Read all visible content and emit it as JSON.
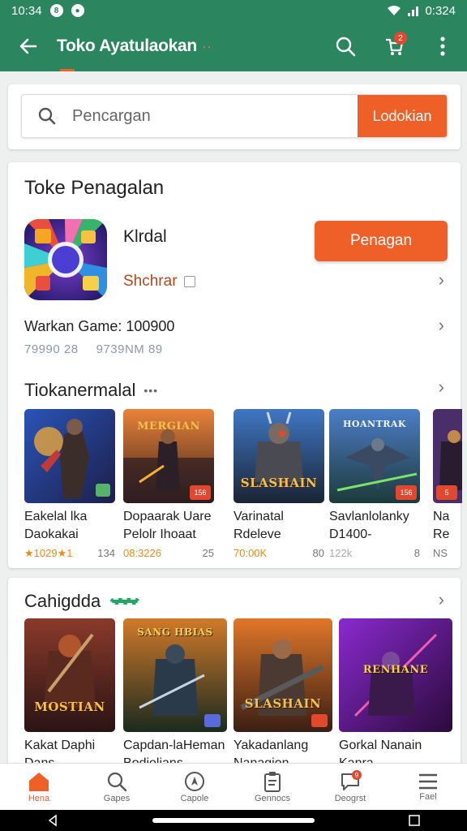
{
  "status_bar": {
    "time": "10:34",
    "battery": "0:324",
    "dot1": "8"
  },
  "app_bar": {
    "title": "Toko Ayatulaokan",
    "title_dots": "··",
    "cart_badge": "2"
  },
  "search": {
    "placeholder": "Pencargan",
    "button_label": "Lodokian"
  },
  "main_section": {
    "title": "Toke Penagalan",
    "featured": {
      "name": "Klrdal",
      "subtitle": "Shchrar",
      "button_label": "Penagan"
    },
    "meta_line": "Warkan Game: 100900",
    "stats": [
      "79990 28",
      "9739NM 89"
    ]
  },
  "row_section": {
    "title": "Tiokanermalal",
    "title_dots": "•••",
    "games": [
      {
        "name1": "Eakelal lka",
        "name2": "Daokakai",
        "rating": "★1029★1",
        "count": "134",
        "logo": "",
        "tag": ""
      },
      {
        "name1": "Dopaarak Uare",
        "name2": "Pelolr Ihoaat",
        "rating": "08:3226",
        "count": "25",
        "logo": "MERGIAN",
        "tag": "156"
      },
      {
        "name1": "Varinatal",
        "name2": "Rdeleve",
        "rating": "70:00K",
        "count": "80",
        "logo": "SLASHAIN",
        "tag": ""
      },
      {
        "name1": "Savlanlolanky",
        "name2": "D1400-",
        "rating": "122k",
        "count": "8",
        "logo": "HOANTRAK",
        "tag": "156"
      },
      {
        "name1": "Na",
        "name2": "Re",
        "rating": "",
        "count": "NS",
        "logo": "",
        "tag": "5"
      }
    ]
  },
  "category_section": {
    "title": "Cahigdda",
    "games": [
      {
        "name1": "Kakat Daphi",
        "name2": "Dans",
        "logo": "MOSTIAN",
        "tag": ""
      },
      {
        "name1": "Capdan-laHeman",
        "name2": "Bodiolians",
        "logo": "SANG HBIAS",
        "tag": ""
      },
      {
        "name1": "Yakadanlang",
        "name2": "Nanagion",
        "logo": "SLASHAIN",
        "tag": ""
      },
      {
        "name1": "Gorkal Nanain",
        "name2": "Kanra",
        "logo": "RENHANE",
        "tag": ""
      }
    ]
  },
  "bottom_nav": [
    {
      "label": "Hena",
      "icon": "home-icon"
    },
    {
      "label": "Gapes",
      "icon": "search-icon"
    },
    {
      "label": "Capole",
      "icon": "compass-icon"
    },
    {
      "label": "Gennocs",
      "icon": "clipboard-icon"
    },
    {
      "label": "Deogrst",
      "icon": "chat-icon",
      "badge": "9"
    },
    {
      "label": "Fael",
      "icon": "menu-icon"
    }
  ],
  "colors": {
    "primary": "#2b8660",
    "accent": "#ef5f28"
  }
}
